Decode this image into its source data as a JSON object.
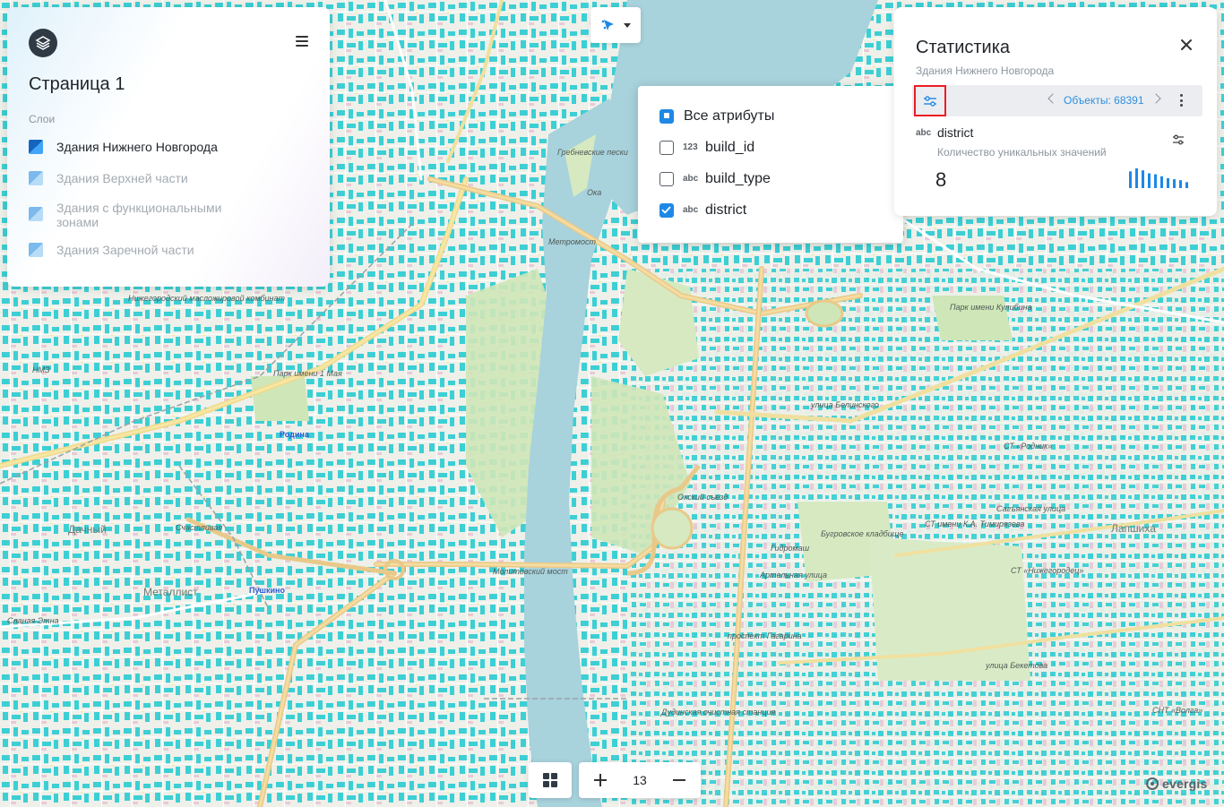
{
  "app": {
    "page_title": "Страница 1",
    "layers_heading": "Слои"
  },
  "layers": [
    {
      "label": "Здания Нижнего Новгорода",
      "active": true,
      "color": "#1a73e8"
    },
    {
      "label": "Здания Верхней части",
      "active": false,
      "color": "#93c6f0"
    },
    {
      "label": "Здания с функциональными зонами",
      "active": false,
      "color": "#93c6f0"
    },
    {
      "label": "Здания Заречной части",
      "active": false,
      "color": "#93c6f0"
    }
  ],
  "tool": {
    "icon": "pointer-icon"
  },
  "attributes_menu": {
    "items": [
      {
        "label": "Все атрибуты",
        "type": "",
        "state": "indeterminate"
      },
      {
        "label": "build_id",
        "type": "123",
        "state": "unchecked"
      },
      {
        "label": "build_type",
        "type": "abc",
        "state": "unchecked"
      },
      {
        "label": "district",
        "type": "abc",
        "state": "checked"
      }
    ]
  },
  "stats": {
    "title": "Статистика",
    "subtitle": "Здания Нижнего Новгорода",
    "objects_label": "Объекты: 68391",
    "field": {
      "type": "abc",
      "name": "district",
      "description": "Количество уникальных значений",
      "value": "8"
    },
    "histogram": [
      0.85,
      1.0,
      0.9,
      0.75,
      0.7,
      0.6,
      0.5,
      0.45,
      0.4,
      0.3
    ]
  },
  "zoom": {
    "level": "13"
  },
  "brand": {
    "name": "evergis"
  },
  "colors": {
    "accent": "#1e88e5",
    "water": "#a8d2dc",
    "building": "#3ccfd4",
    "highlight": "#ee1c24"
  },
  "map_labels": [
    {
      "text": "Гребневские пески",
      "cls": ""
    },
    {
      "text": "Метромост",
      "cls": ""
    },
    {
      "text": "Ока",
      "cls": ""
    },
    {
      "text": "Парк имени 1 Мая",
      "cls": ""
    },
    {
      "text": "Родина",
      "cls": "metro"
    },
    {
      "text": "Счастливая",
      "cls": ""
    },
    {
      "text": "Пушкино",
      "cls": "metro"
    },
    {
      "text": "Дачный",
      "cls": "big"
    },
    {
      "text": "Металлист",
      "cls": "big"
    },
    {
      "text": "НМЗ",
      "cls": ""
    },
    {
      "text": "Молитовский мост",
      "cls": ""
    },
    {
      "text": "Бугровское кладбище",
      "cls": ""
    },
    {
      "text": "Гидромаш",
      "cls": ""
    },
    {
      "text": "Парк имени Кулибина",
      "cls": ""
    },
    {
      "text": "СТ «Родник»",
      "cls": ""
    },
    {
      "text": "Лапшиха",
      "cls": "big"
    },
    {
      "text": "СТ «Нижегородец»",
      "cls": ""
    },
    {
      "text": "улица Бекетова",
      "cls": ""
    },
    {
      "text": "Окский съезд",
      "cls": ""
    },
    {
      "text": "Сланая Этна",
      "cls": ""
    },
    {
      "text": "Нижегородский масложировой комбинат",
      "cls": ""
    },
    {
      "text": "Дудинская очистная станция",
      "cls": ""
    },
    {
      "text": "Артельная улица",
      "cls": ""
    },
    {
      "text": "улица Белинского",
      "cls": ""
    },
    {
      "text": "Сагъянская улица",
      "cls": ""
    },
    {
      "text": "СТ имени К.А. Тимирязева",
      "cls": ""
    },
    {
      "text": "СНТ «Волга»",
      "cls": ""
    },
    {
      "text": "проспект Гагарина",
      "cls": ""
    }
  ]
}
